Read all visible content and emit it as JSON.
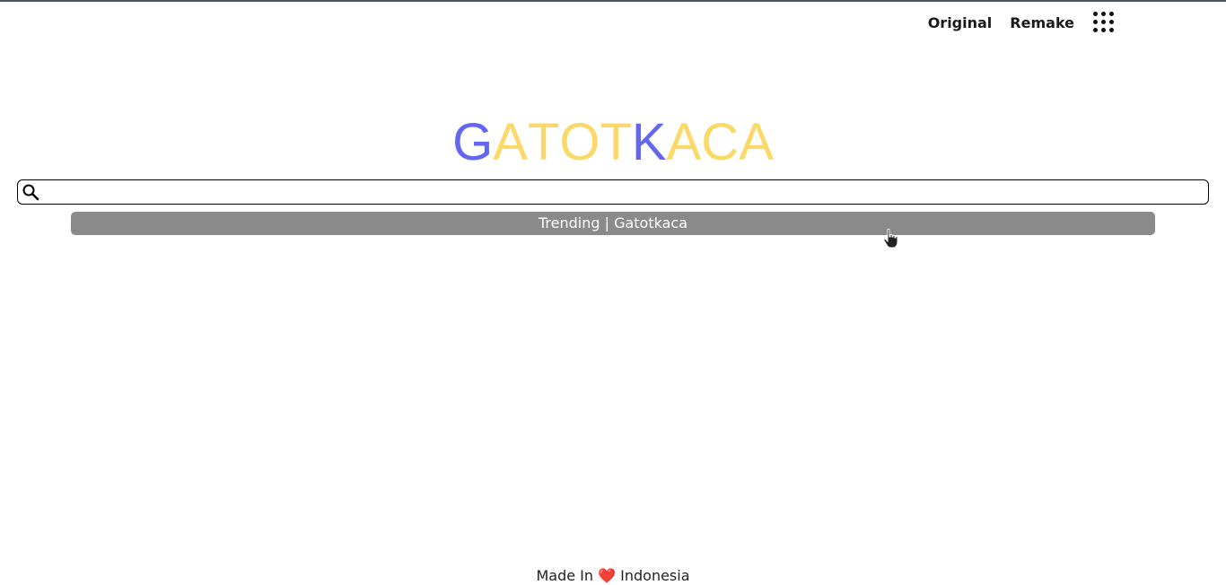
{
  "nav": {
    "original_label": "Original",
    "remake_label": "Remake",
    "apps_icon": "apps-grid-icon"
  },
  "logo": {
    "letters": [
      "G",
      "A",
      "T",
      "O",
      "T",
      "K",
      "A",
      "C",
      "A"
    ],
    "colors": [
      "#6366f1",
      "#fcd966",
      "#fcd966",
      "#fcd966",
      "#fcd966",
      "#6366f1",
      "#fcd966",
      "#fcd966",
      "#fcd966"
    ]
  },
  "search": {
    "value": "",
    "placeholder": "",
    "icon": "search-icon"
  },
  "trending": {
    "label": "Trending | Gatotkaca"
  },
  "footer": {
    "prefix": "Made In",
    "heart": "❤️",
    "suffix": "Indonesia"
  }
}
